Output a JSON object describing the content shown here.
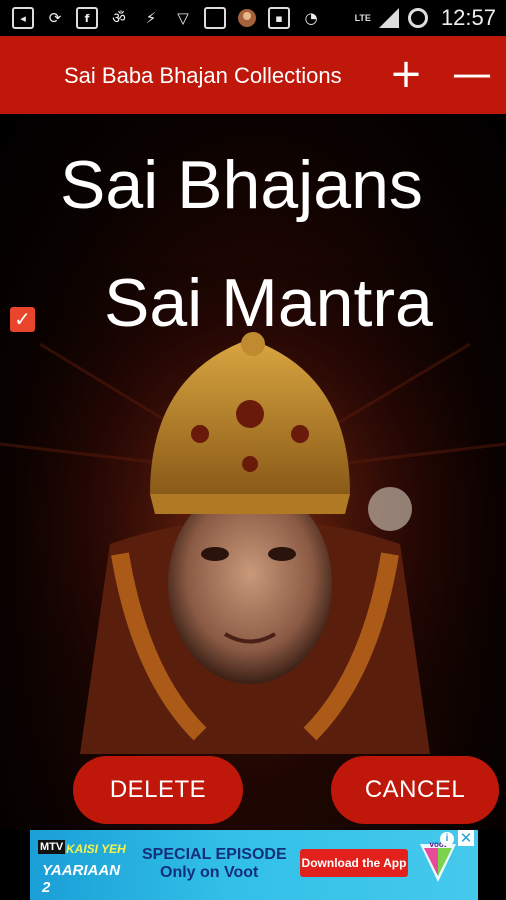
{
  "status_bar": {
    "icons": [
      "back-icon",
      "sync-icon",
      "facebook-icon",
      "om-icon",
      "bolt-icon",
      "wifi-icon",
      "square-icon",
      "avatar-icon",
      "app-icon",
      "data-saver-icon"
    ],
    "network": "LTE",
    "time": "12:57"
  },
  "app_bar": {
    "title": "Sai Baba Bhajan Collections",
    "add_label": "+",
    "remove_label": "—"
  },
  "list": {
    "items": [
      {
        "label": "Sai Bhajans",
        "checked": false
      },
      {
        "label": "Sai Mantra",
        "checked": true
      }
    ]
  },
  "actions": {
    "delete_label": "DELETE",
    "cancel_label": "CANCEL"
  },
  "ad": {
    "brand_line1": "KAISI YEH",
    "brand_line2": "YAARIAAN 2",
    "channel": "MTV",
    "text_line1": "SPECIAL EPISODE",
    "text_line2": "Only on Voot",
    "cta": "Download the App",
    "partner": "voot",
    "info": "i",
    "close": "✕"
  },
  "colors": {
    "primary": "#c0170b",
    "checkbox": "#e8452c",
    "ad_bg": "#32c0e8"
  }
}
